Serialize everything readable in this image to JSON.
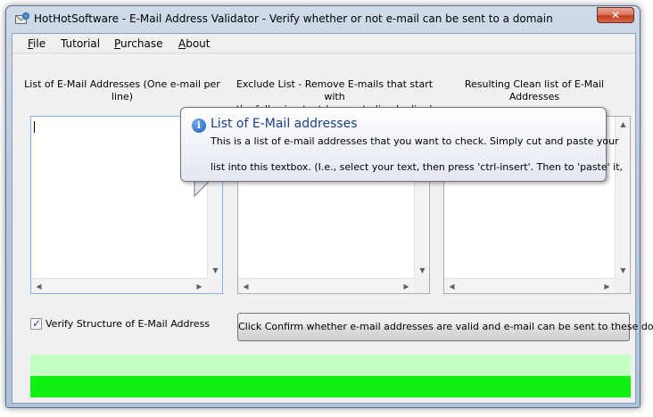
{
  "window": {
    "title": "HotHotSoftware - E-Mail Address Validator - Verify whether or not e-mail can be sent to a domain",
    "close_label": "✕"
  },
  "menu": [
    {
      "label": "File",
      "accel": "F",
      "rest": "ile"
    },
    {
      "label": "Tutorial",
      "accel": "",
      "rest": "Tutorial"
    },
    {
      "label": "Purchase",
      "accel": "P",
      "rest": "urchase"
    },
    {
      "label": "About",
      "accel": "A",
      "rest": "bout"
    }
  ],
  "columns": {
    "input_label": "List of E-Mail Addresses (One e-mail per line)",
    "exclude_label_line1": "Exclude List - Remove E-mails that start with",
    "exclude_label_line2": "the following text (separate line by line)",
    "result_label": "Resulting Clean list of E-Mail Addresses"
  },
  "checkbox": {
    "label": "Verify Structure of E-Mail Address",
    "checked": true
  },
  "confirm_button": "Click Confirm whether e-mail addresses are valid and e-mail can be sent to these domains",
  "tooltip": {
    "title": "List of E-Mail addresses",
    "line1": "This is a list of e-mail addresses that you want to check.  Simply cut and paste your",
    "line2": "list into this textbox.  (I.e., select your text, then press 'ctrl-insert'.  Then to 'paste' it,"
  },
  "icons": {
    "app": "envelope-globe-icon",
    "info": "info-icon",
    "scroll_up": "▲",
    "scroll_down": "▼",
    "scroll_left": "◀",
    "scroll_right": "▶"
  },
  "colors": {
    "progress_light": "#c3ffc3",
    "progress_fill": "#12f012",
    "tooltip_title": "#1c3c8c"
  },
  "progress": {
    "value": 1.0
  }
}
